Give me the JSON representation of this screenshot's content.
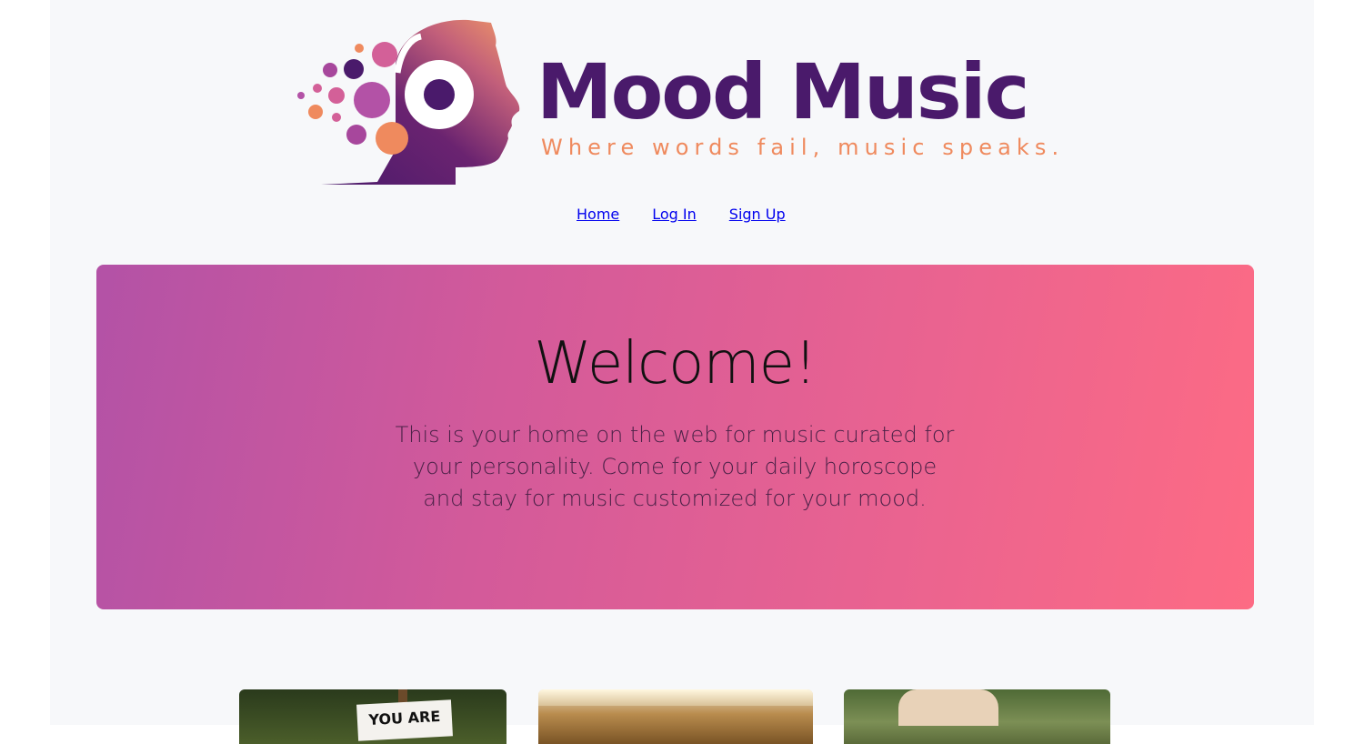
{
  "logo": {
    "title": "Mood Music",
    "tagline": "Where words fail, music speaks.",
    "icon": "head-with-headphones-icon",
    "colors": {
      "primary": "#4a1a6b",
      "accent": "#ef8a5e",
      "pink": "#d36098"
    }
  },
  "nav": {
    "items": [
      {
        "label": "Home"
      },
      {
        "label": "Log In"
      },
      {
        "label": "Sign Up"
      }
    ],
    "link_color": "#1769d6"
  },
  "hero": {
    "title": "Welcome!",
    "text": "This is your home on the web for music curated for your personality. Come for your daily horoscope and stay for music customized for your mood.",
    "gradient": [
      "#b352a6",
      "#fd6b84"
    ]
  },
  "cards": [
    {
      "image": "sign-outdoors-photo",
      "sign_text": "YOU ARE"
    },
    {
      "image": "interior-photo"
    },
    {
      "image": "hand-garden-photo"
    }
  ]
}
